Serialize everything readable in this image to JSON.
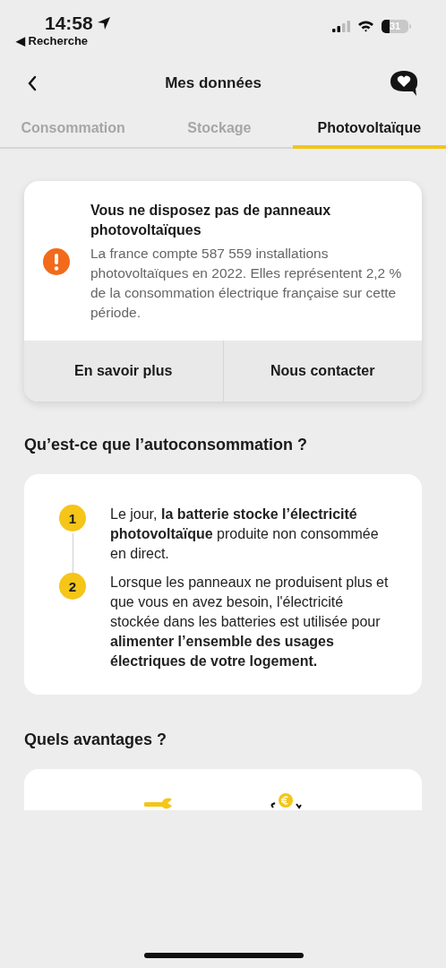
{
  "status_bar": {
    "time": "14:58",
    "back_app": "◀ Recherche",
    "battery": "31"
  },
  "header": {
    "title": "Mes données"
  },
  "tabs": [
    {
      "label": "Consommation",
      "selected": false
    },
    {
      "label": "Stockage",
      "selected": false
    },
    {
      "label": "Photovoltaïque",
      "selected": true
    }
  ],
  "alert": {
    "title": "Vous ne disposez pas de panneaux photovoltaïques",
    "body": "La france compte 587 559 installations photovoltaïques en 2022. Elles représentent 2,2 % de la consommation électrique française sur cette période.",
    "buttons": [
      "En savoir plus",
      "Nous contacter"
    ]
  },
  "section_1": {
    "heading": "Qu’est-ce que l’autoconsommation ?",
    "steps": [
      {
        "number": "1",
        "text": "Le jour, **la batterie stocke l’électricité photovoltaïque** produite non consommée en direct."
      },
      {
        "number": "2",
        "text": "Lorsque les panneaux ne produisent plus et que vous en avez besoin, l'électricité stockée dans les batteries est utilisée pour **alimenter l’ensemble des usages électriques de votre logement.**"
      }
    ]
  },
  "section_2": {
    "heading": "Quels avantages ?"
  }
}
